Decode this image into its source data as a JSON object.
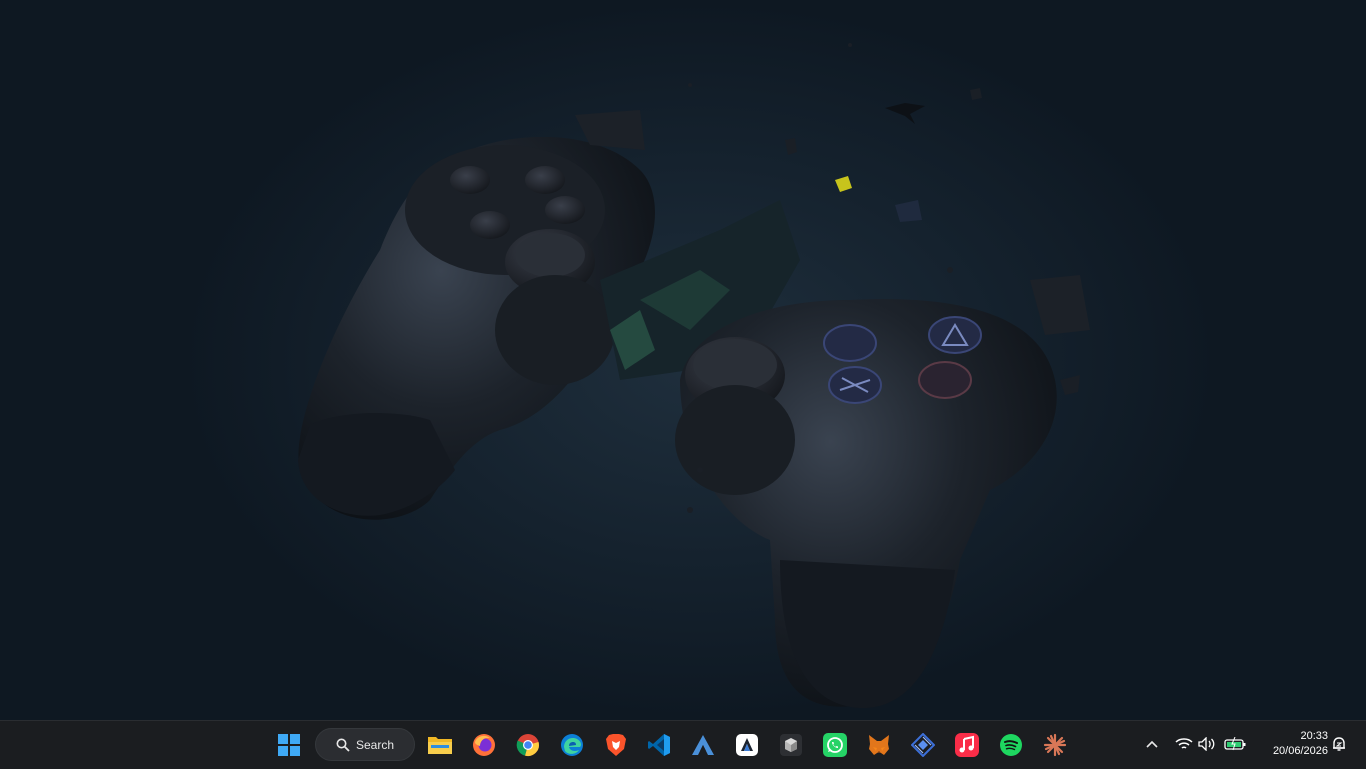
{
  "taskbar": {
    "search_label": "Search",
    "apps": [
      {
        "name": "start-icon"
      },
      {
        "name": "file-explorer-icon"
      },
      {
        "name": "firefox-icon"
      },
      {
        "name": "chrome-icon"
      },
      {
        "name": "edge-icon"
      },
      {
        "name": "brave-icon"
      },
      {
        "name": "vscode-icon"
      },
      {
        "name": "arch-icon"
      },
      {
        "name": "app-a-icon"
      },
      {
        "name": "cube-app-icon"
      },
      {
        "name": "whatsapp-icon"
      },
      {
        "name": "metamask-icon"
      },
      {
        "name": "network-app-icon"
      },
      {
        "name": "apple-music-icon"
      },
      {
        "name": "spotify-icon"
      },
      {
        "name": "claude-icon"
      }
    ]
  },
  "tray": {
    "time": "20:33",
    "date": "20/06/2026",
    "icons": [
      "chevron-up-icon",
      "wifi-icon",
      "volume-icon",
      "battery-icon",
      "notification-icon"
    ]
  },
  "colors": {
    "taskbar_bg": "#1b1d20",
    "desktop_bg": "#0f1a24",
    "accent_blue": "#2b8ae6"
  },
  "wallpaper": {
    "subject": "exploding-gamepad"
  }
}
